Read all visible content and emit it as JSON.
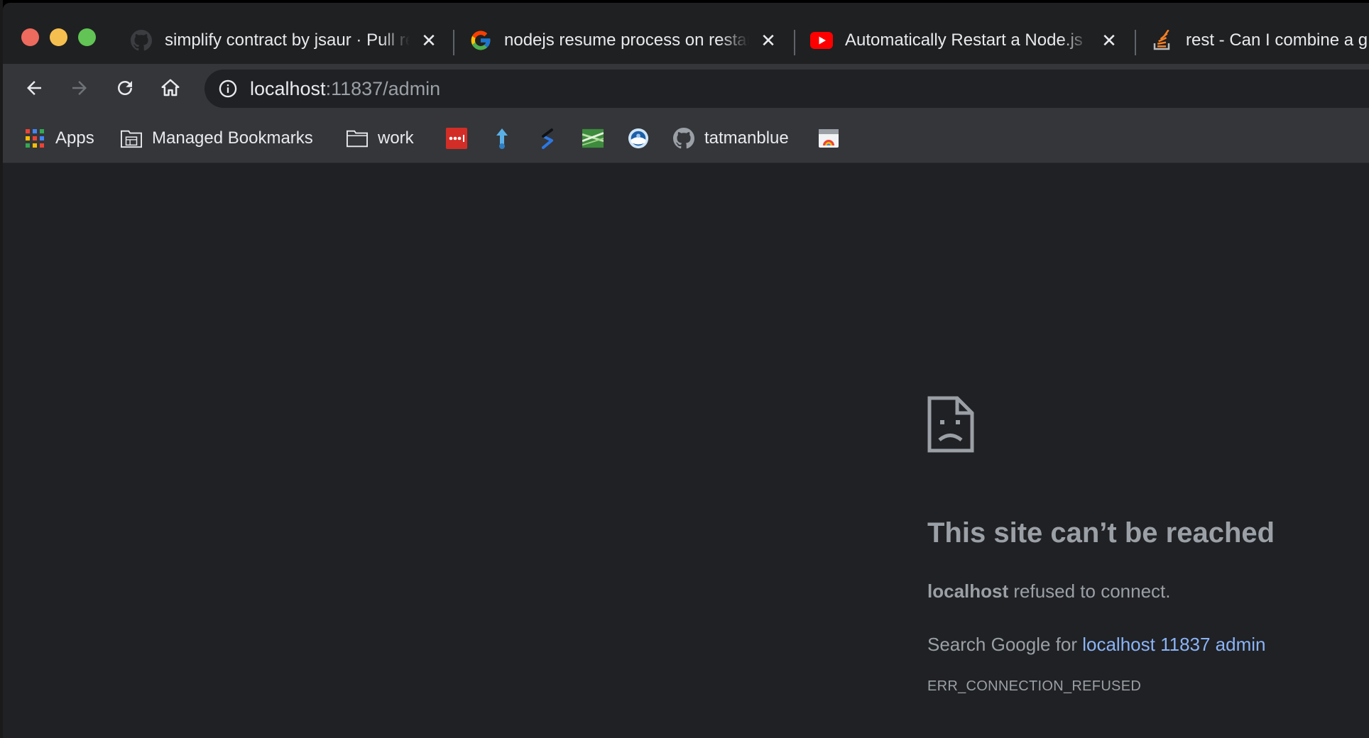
{
  "tabs": [
    {
      "title": "simplify contract by jsaur · Pull request",
      "favicon": "github-icon",
      "close": "✕"
    },
    {
      "title": "nodejs resume process on restart",
      "favicon": "google-icon",
      "close": "✕"
    },
    {
      "title": "Automatically Restart a Node.js",
      "favicon": "youtube-icon",
      "close": "✕"
    },
    {
      "title": "rest - Can I combine a g",
      "favicon": "stackoverflow-icon"
    }
  ],
  "address": {
    "host": "localhost",
    "rest": ":11837/admin"
  },
  "bookmarks": {
    "apps": "Apps",
    "managed": "Managed Bookmarks",
    "work": "work",
    "tatmanblue": "tatmanblue"
  },
  "error": {
    "title": "This site can’t be reached",
    "host": "localhost",
    "message": " refused to connect.",
    "search_prefix": "Search Google for ",
    "search_link": "localhost 11837 admin",
    "code": "ERR_CONNECTION_REFUSED"
  },
  "colors": {
    "accent_link": "#8ab4f8",
    "background": "#202124",
    "toolbar": "#35363a"
  }
}
